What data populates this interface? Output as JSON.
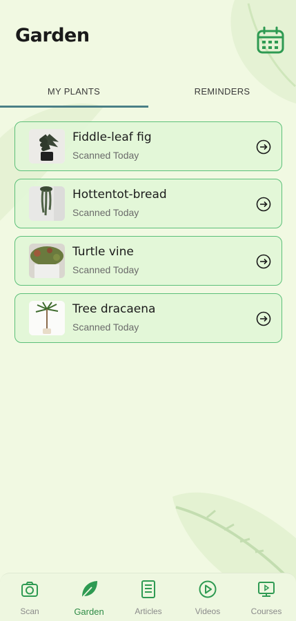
{
  "header": {
    "title": "Garden",
    "calendar_icon": "calendar-icon"
  },
  "tabs": [
    {
      "label": "MY PLANTS",
      "active": true
    },
    {
      "label": "REMINDERS",
      "active": false
    }
  ],
  "plants": [
    {
      "name": "Fiddle-leaf fig",
      "status": "Scanned Today"
    },
    {
      "name": "Hottentot-bread",
      "status": "Scanned Today"
    },
    {
      "name": "Turtle vine",
      "status": "Scanned Today"
    },
    {
      "name": "Tree dracaena",
      "status": "Scanned Today"
    }
  ],
  "bottom_nav": [
    {
      "label": "Scan",
      "icon": "camera-icon",
      "active": false
    },
    {
      "label": "Garden",
      "icon": "leaf-icon",
      "active": true
    },
    {
      "label": "Articles",
      "icon": "document-icon",
      "active": false
    },
    {
      "label": "Videos",
      "icon": "play-icon",
      "active": false
    },
    {
      "label": "Courses",
      "icon": "courses-icon",
      "active": false
    }
  ],
  "colors": {
    "accent": "#2e8b46",
    "card_border": "#5bbf78",
    "background": "#f1f9e2",
    "tab_indicator": "#4a7f86"
  }
}
